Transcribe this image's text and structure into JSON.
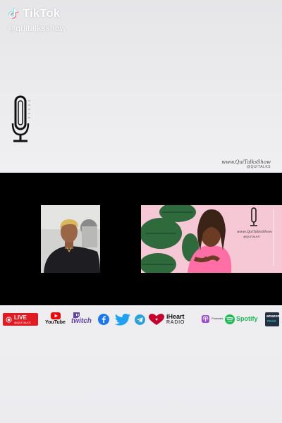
{
  "tiktok": {
    "app_name": "TikTok",
    "handle": "@quitalksshow"
  },
  "brand": {
    "script_name": "www.QuiTalksShow",
    "handle_small": "@QUITALKS"
  },
  "video_overlay": {
    "panel_brand_script": "www.QuiTalksShow",
    "panel_brand_handle": "@QUITALKS"
  },
  "social_bar": {
    "live_label": "LIVE",
    "live_handle": "@QUITALKS",
    "youtube_label": "YouTube",
    "twitch_label": "twitch",
    "iheart_label_top": "iHeart",
    "iheart_label_bottom": "RADIO",
    "podcasts_label": "Podcasts",
    "spotify_label": "Spotify",
    "amazon_label_top": "amazon",
    "amazon_label_bottom": "music"
  },
  "colors": {
    "live_red": "#e11b22",
    "youtube_red": "#ff0000",
    "twitch_purple": "#6441a5",
    "facebook_blue": "#1877f2",
    "twitter_blue": "#1da1f2",
    "telegram_blue": "#2aa3d8",
    "iheart_red": "#c6002b",
    "podcasts_purple": "#9b4dd3",
    "spotify_green": "#1db954",
    "amazon_music_navy": "#232f3e"
  },
  "icons": [
    "tiktok-logo-icon",
    "microphone-icon",
    "youtube-icon",
    "twitch-icon",
    "facebook-icon",
    "twitter-icon",
    "telegram-icon",
    "iheart-icon",
    "podcasts-icon",
    "spotify-icon",
    "amazon-music-icon"
  ]
}
